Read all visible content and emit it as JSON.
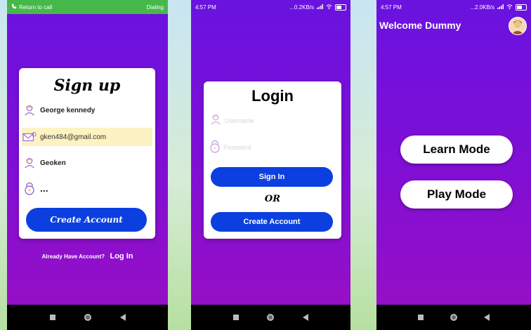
{
  "signup_screen": {
    "status_left": "Return to call",
    "status_right": "Dialing",
    "title": "Sign up",
    "fields": {
      "name_value": "George kennedy",
      "email_value": "gken484@gmail.com",
      "username_value": "Geoken",
      "password_value": "..."
    },
    "create_label": "Create Account",
    "footer_question": "Already Have Account?",
    "footer_login": "Log In"
  },
  "login_screen": {
    "status_time": "4:57 PM",
    "status_speed": "...0.2KB/s",
    "title": "Login",
    "username_placeholder": "Username",
    "password_placeholder": "Password",
    "signin_label": "Sign In",
    "or_label": "OR",
    "create_label": "Create Account"
  },
  "home_screen": {
    "status_time": "4:57 PM",
    "status_speed": "...2.0KB/s",
    "welcome": "Welcome Dummy",
    "learn_label": "Learn Mode",
    "play_label": "Play Mode"
  },
  "colors": {
    "accent_blue": "#0b3fe0",
    "gradient_top": "#6a12e0",
    "gradient_bottom": "#9a0fc4",
    "call_bar": "#46b84a",
    "highlight": "#fcf2c2"
  },
  "icons": [
    "user-icon",
    "email-icon",
    "lock-icon",
    "phone-icon",
    "wifi-icon",
    "signal-icon",
    "battery-icon",
    "avatar-icon"
  ]
}
